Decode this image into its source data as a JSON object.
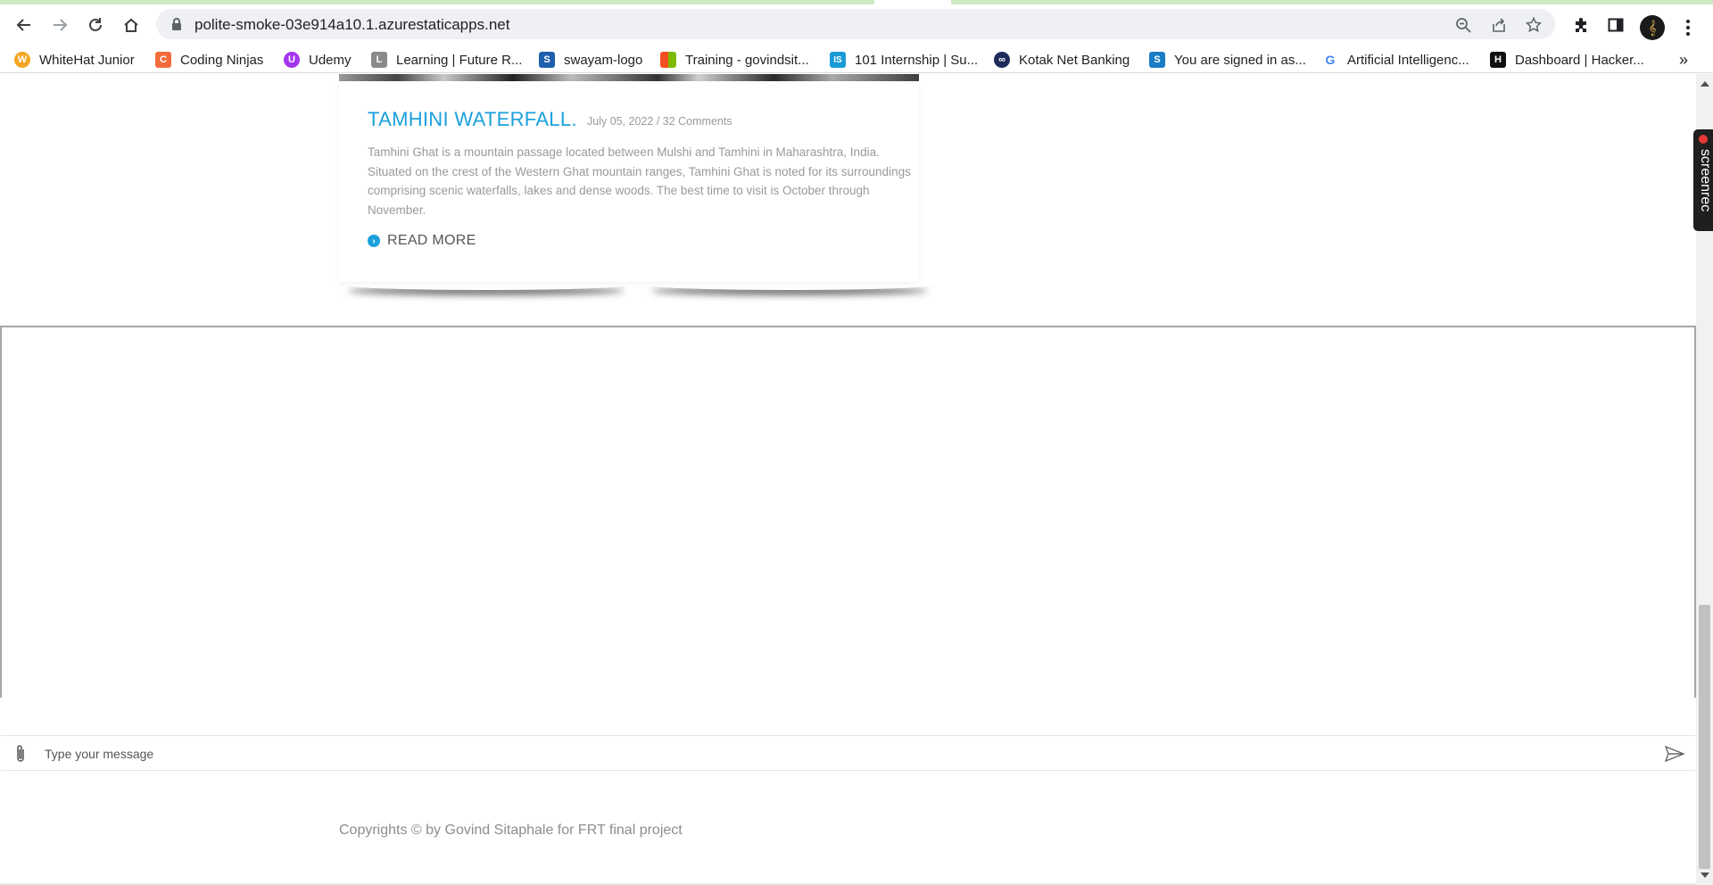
{
  "browser": {
    "url": "polite-smoke-03e914a10.1.azurestaticapps.net",
    "nav_icons": {
      "back": "back-arrow-icon",
      "forward": "forward-arrow-icon",
      "reload": "reload-icon",
      "home": "home-icon"
    },
    "bookmarks": [
      {
        "label": "WhiteHat Junior",
        "icon": "whitehat-junior-favicon",
        "color": "#f5a623",
        "glyph": "W"
      },
      {
        "label": "Coding Ninjas",
        "icon": "coding-ninjas-favicon",
        "color": "#f26b3a",
        "glyph": "C"
      },
      {
        "label": "Udemy",
        "icon": "udemy-favicon",
        "color": "#a435f0",
        "glyph": "U"
      },
      {
        "label": "Learning | Future R...",
        "icon": "future-skills-favicon",
        "color": "#8a8a8a",
        "glyph": "L"
      },
      {
        "label": "swayam-logo",
        "icon": "swayam-favicon",
        "color": "#1f5fae",
        "glyph": "S"
      },
      {
        "label": "Training - govindsit...",
        "icon": "microsoft-favicon",
        "color": "#f25022",
        "glyph": ""
      },
      {
        "label": "101 Internship | Su...",
        "icon": "internshala-favicon",
        "color": "#1a9ad6",
        "glyph": "IS"
      },
      {
        "label": "Kotak Net Banking",
        "icon": "kotak-favicon",
        "color": "#1e2a5a",
        "glyph": "∞"
      },
      {
        "label": "You are signed in as...",
        "icon": "signed-in-favicon",
        "color": "#1a7cc4",
        "glyph": "S"
      },
      {
        "label": "Artificial Intelligenc...",
        "icon": "google-favicon",
        "color": "#4285f4",
        "glyph": "G"
      },
      {
        "label": "Dashboard | Hacker...",
        "icon": "hackerrank-favicon",
        "color": "#111111",
        "glyph": "H"
      }
    ]
  },
  "post": {
    "title": "TAMHINI WATERFALL.",
    "meta": "July 05, 2022 / 32 Comments",
    "body": "Tamhini Ghat is a mountain passage located between Mulshi and Tamhini in Maharashtra, India. Situated on the crest of the Western Ghat mountain ranges, Tamhini Ghat is noted for its surroundings comprising scenic waterfalls, lakes and dense woods. The best time to visit is October through November.",
    "read_more": "READ MORE"
  },
  "chat": {
    "placeholder": "Type your message"
  },
  "footer": {
    "copyright": "Copyrights © by Govind Sitaphale for FRT final project"
  },
  "extension": {
    "label": "screenrec"
  },
  "colors": {
    "accent": "#1aa0dc",
    "muted_text": "#9a9a9a"
  }
}
